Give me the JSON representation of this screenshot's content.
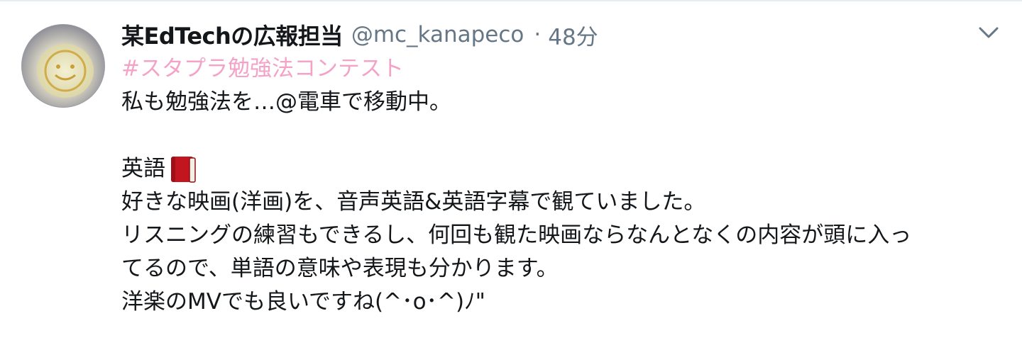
{
  "tweet": {
    "display_name": "某EdTechの広報担当",
    "handle": "@mc_kanapeco",
    "separator": "·",
    "time": "48分",
    "hashtag": "#スタプラ勉強法コンテスト",
    "lines": {
      "l1": "私も勉強法を…@電車で移動中。",
      "subject": "英語",
      "l3": "好きな映画(洋画)を、音声英語&英語字幕で観ていました。",
      "l4": "リスニングの練習もできるし、何回も観た映画ならなんとなくの内容が頭に入っ",
      "l5": "てるので、単語の意味や表現も分かります。",
      "l6": "洋楽のMVでも良いですね(^･o･^)ﾉ\""
    }
  },
  "icons": {
    "avatar": "avatar-photo",
    "book": "red-book-emoji",
    "menu": "chevron-down-icon"
  },
  "colors": {
    "hashtag": "#f4a3c8",
    "secondary_text": "#657786",
    "book_red": "#c2151f"
  }
}
